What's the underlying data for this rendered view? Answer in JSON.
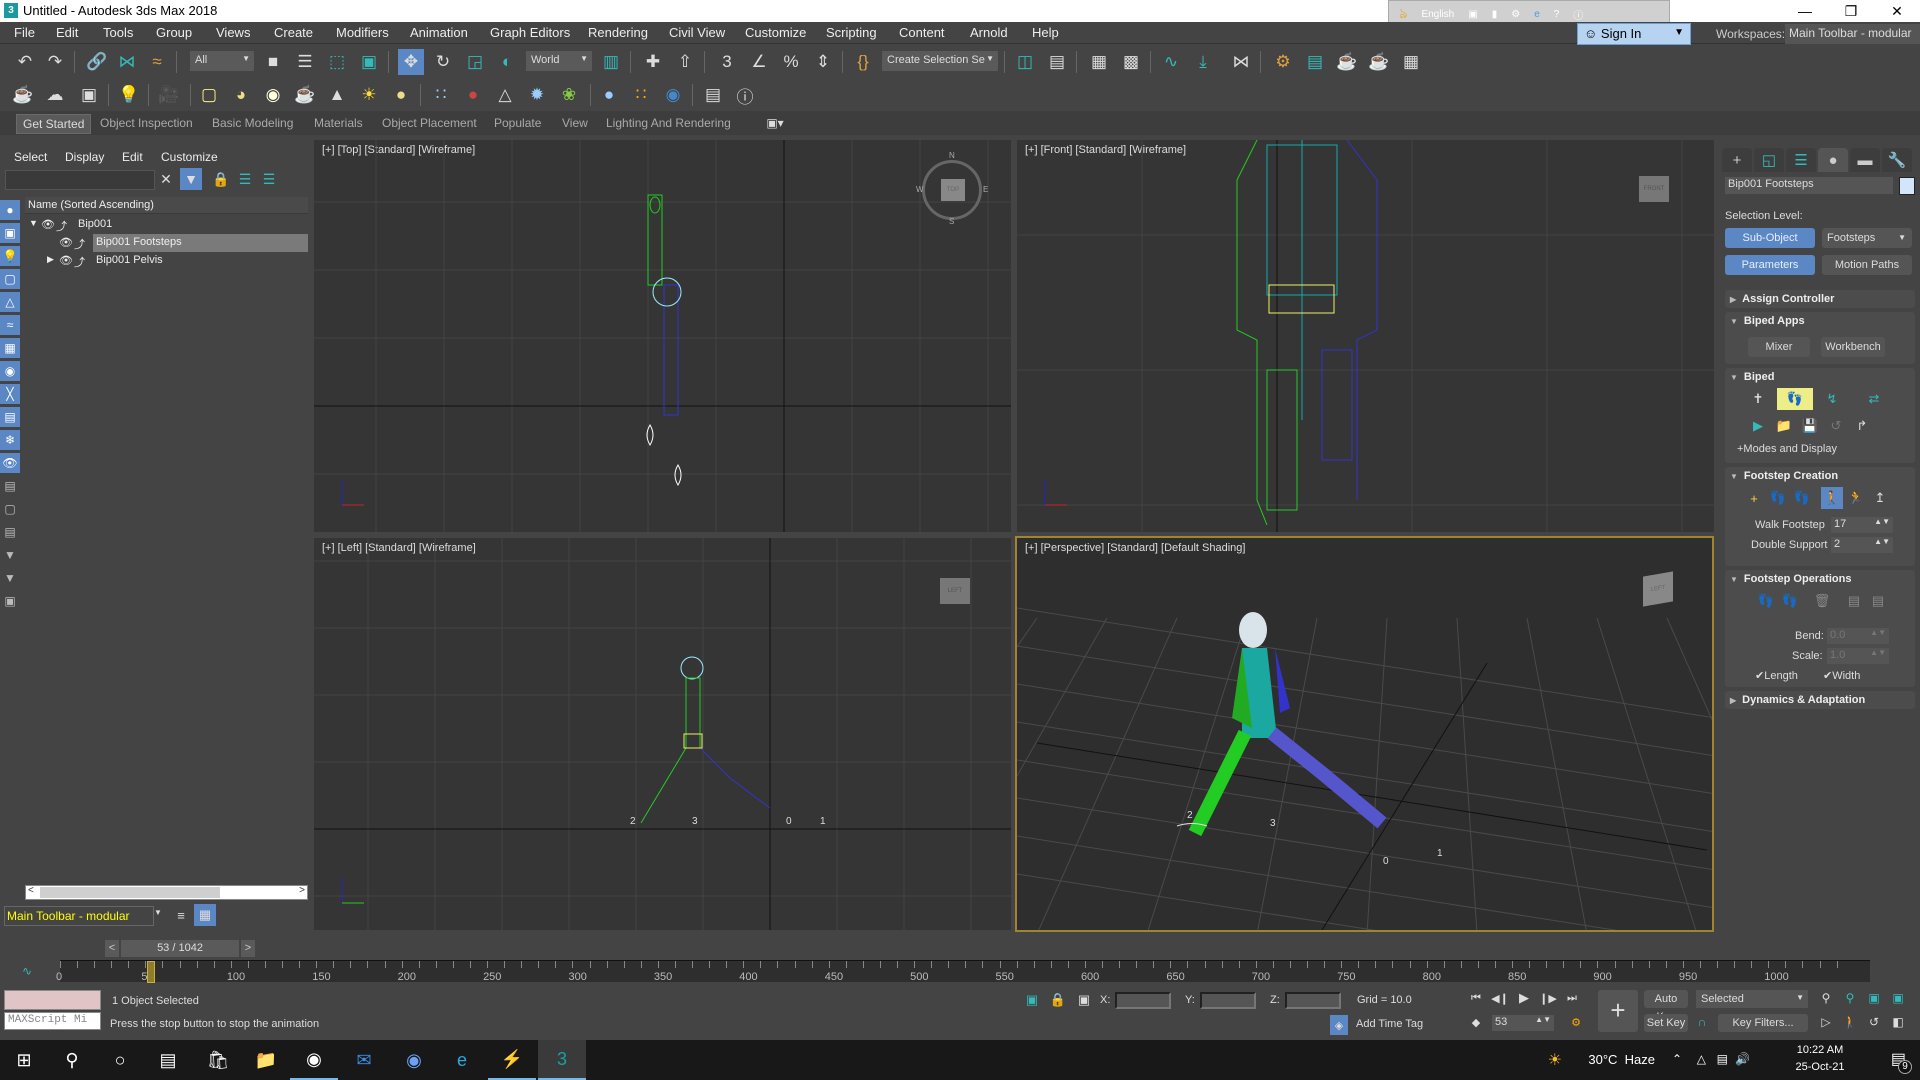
{
  "window": {
    "title": "Untitled - Autodesk 3ds Max 2018",
    "controls": [
      "minimize",
      "restore",
      "close"
    ]
  },
  "ime_bar": {
    "language": "English"
  },
  "menu": [
    "File",
    "Edit",
    "Tools",
    "Group",
    "Views",
    "Create",
    "Modifiers",
    "Animation",
    "Graph Editors",
    "Rendering",
    "Civil View",
    "Customize",
    "Scripting",
    "Content",
    "Arnold",
    "Help"
  ],
  "account": {
    "sign_in": "Sign In",
    "workspaces_label": "Workspaces:",
    "workspace": "Main Toolbar - modular"
  },
  "main_toolbar": {
    "selection_filter": "All",
    "reference_coord": "World",
    "named_selection": "Create Selection Se",
    "tools": [
      "undo",
      "redo",
      "select-and-link",
      "unlink",
      "bind-to-space-warp",
      "select-object",
      "select-by-name",
      "rectangular-selection",
      "window-crossing",
      "select-and-move",
      "select-and-rotate",
      "select-and-scale",
      "select-and-place",
      "use-pivot-center",
      "select-and-manipulate",
      "keyboard-shortcut-override",
      "snaps-3d",
      "angle-snap",
      "percent-snap",
      "spinner-snap",
      "edit-named-selection",
      "mirror",
      "align",
      "toggle-scene-explorer",
      "toggle-layer-explorer",
      "curve-editor",
      "dope-sheet",
      "schematic-view",
      "material-editor",
      "render-setup",
      "rendered-frame-window",
      "render-production",
      "render-in-cloud",
      "render-shortcuts"
    ]
  },
  "second_toolbar": {
    "tools": [
      "teapot",
      "cloud",
      "environment",
      "light-lister",
      "camera",
      "plane",
      "dome",
      "sphere-light",
      "teapot-wire",
      "cone",
      "sun",
      "omni",
      "particles",
      "dynamics",
      "tripod",
      "spiky-ball",
      "grass",
      "sphere",
      "colors",
      "render-element",
      "asset-tracking",
      "help"
    ]
  },
  "ribbon": {
    "tabs": [
      "Get Started",
      "Object Inspection",
      "Basic Modeling",
      "Materials",
      "Object Placement",
      "Populate",
      "View",
      "Lighting And Rendering"
    ],
    "active": "Get Started"
  },
  "scene_explorer": {
    "menu": [
      "Select",
      "Display",
      "Edit",
      "Customize"
    ],
    "search_value": "",
    "column_header": "Name (Sorted Ascending)",
    "rows": [
      {
        "name": "Bip001",
        "level": 0,
        "expanded": true,
        "selected": false
      },
      {
        "name": "Bip001 Footsteps",
        "level": 1,
        "expanded": null,
        "selected": true
      },
      {
        "name": "Bip001 Pelvis",
        "level": 1,
        "expanded": false,
        "selected": false
      }
    ],
    "workspace": "Main Toolbar - modular"
  },
  "viewports": [
    {
      "label": "[+] [Top] [Standard] [Wireframe]",
      "viewcube": "TOP",
      "compass": [
        "N",
        "S",
        "E",
        "W"
      ]
    },
    {
      "label": "[+] [Front] [Standard] [Wireframe]",
      "viewcube": "FRONT"
    },
    {
      "label": "[+] [Left] [Standard] [Wireframe]",
      "viewcube": "LEFT",
      "footstep_numbers": [
        "2",
        "3",
        "0",
        "1"
      ]
    },
    {
      "label": "[+] [Perspective] [Standard] [Default Shading]",
      "viewcube": "LEFT",
      "active": true,
      "footstep_numbers": [
        "2",
        "3",
        "0",
        "1"
      ]
    }
  ],
  "command_panel": {
    "tabs": [
      "create",
      "modify",
      "hierarchy",
      "motion",
      "display",
      "utilities"
    ],
    "active_tab": "motion",
    "object_name": "Bip001 Footsteps",
    "object_color": "#d3e5fb",
    "selection_level_label": "Selection Level:",
    "sub_object_button": "Sub-Object",
    "sub_object_type": "Footsteps",
    "parameters_button": "Parameters",
    "motion_paths_button": "Motion Paths",
    "rollouts": {
      "assign_controller": "Assign Controller",
      "biped_apps": {
        "title": "Biped Apps",
        "buttons": [
          "Mixer",
          "Workbench"
        ]
      },
      "biped": {
        "title": "Biped",
        "modes_label": "+Modes and Display",
        "icons": [
          "figure-mode",
          "footstep-mode",
          "motion-flow-mode",
          "mixer-mode",
          "play-biped",
          "load-file",
          "save-file",
          "copy-paste-posture",
          "buffer-mode"
        ]
      },
      "footstep_creation": {
        "title": "Footstep Creation",
        "walk_footstep_label": "Walk Footstep",
        "walk_footstep": "17",
        "double_support_label": "Double Support",
        "double_support": "2",
        "icons": [
          "create-footsteps-append",
          "create-footsteps-current",
          "create-multiple-footsteps",
          "walk",
          "run",
          "jump"
        ],
        "active_gait": "walk"
      },
      "footstep_operations": {
        "title": "Footstep Operations",
        "bend_label": "Bend:",
        "bend": "0.0",
        "scale_label": "Scale:",
        "scale": "1.0",
        "length_label": "Length",
        "length_checked": true,
        "width_label": "Width",
        "width_checked": true
      },
      "dynamics": "Dynamics & Adaptation"
    }
  },
  "timeline": {
    "frame_display": "53 / 1042",
    "current_frame": 53,
    "total_frames": 1042,
    "tick_labels": [
      "0",
      "50",
      "100",
      "150",
      "200",
      "250",
      "300",
      "350",
      "400",
      "450",
      "500",
      "550",
      "600",
      "650",
      "700",
      "750",
      "800",
      "850",
      "900",
      "950",
      "1000"
    ]
  },
  "status": {
    "maxscript_placeholder": "MAXScript Mi",
    "selection": "1 Object Selected",
    "prompt": "Press the stop button to stop the animation",
    "x_label": "X:",
    "y_label": "Y:",
    "z_label": "Z:",
    "x": "",
    "y": "",
    "z": "",
    "grid": "Grid = 10.0",
    "add_time_tag": "Add Time Tag",
    "auto_key": "Auto Key",
    "set_key": "Set Key",
    "key_mode": "Selected",
    "key_filters": "Key Filters...",
    "frame_spinner": "53"
  },
  "taskbar": {
    "apps": [
      "start",
      "search",
      "cortana",
      "task-view",
      "microsoft-store",
      "file-explorer",
      "chrome",
      "mail",
      "chromium",
      "edge",
      "messenger",
      "3ds-max"
    ],
    "active": "3ds-max",
    "weather": "30°C  Haze",
    "time": "10:22 AM",
    "date": "25-Oct-21",
    "notifications": "9"
  }
}
